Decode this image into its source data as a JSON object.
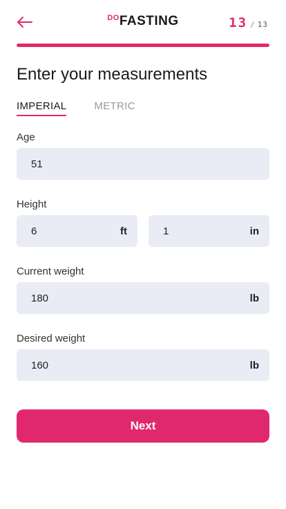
{
  "header": {
    "back_icon": "arrow-left-icon",
    "logo_prefix": "DO",
    "logo_main": "FASTING",
    "step_current": "13",
    "step_separator": "/",
    "step_total": "13",
    "progress_fraction": 1.0
  },
  "page": {
    "title": "Enter your measurements"
  },
  "tabs": [
    {
      "label": "IMPERIAL",
      "active": true
    },
    {
      "label": "METRIC",
      "active": false
    }
  ],
  "form": {
    "age": {
      "label": "Age",
      "value": "51"
    },
    "height": {
      "label": "Height",
      "feet_value": "6",
      "feet_unit": "ft",
      "inches_value": "1",
      "inches_unit": "in"
    },
    "current_weight": {
      "label": "Current weight",
      "value": "180",
      "unit": "lb"
    },
    "desired_weight": {
      "label": "Desired weight",
      "value": "160",
      "unit": "lb"
    }
  },
  "actions": {
    "next_label": "Next"
  },
  "colors": {
    "accent": "#e0296d",
    "field_bg": "#e9ecf4"
  }
}
